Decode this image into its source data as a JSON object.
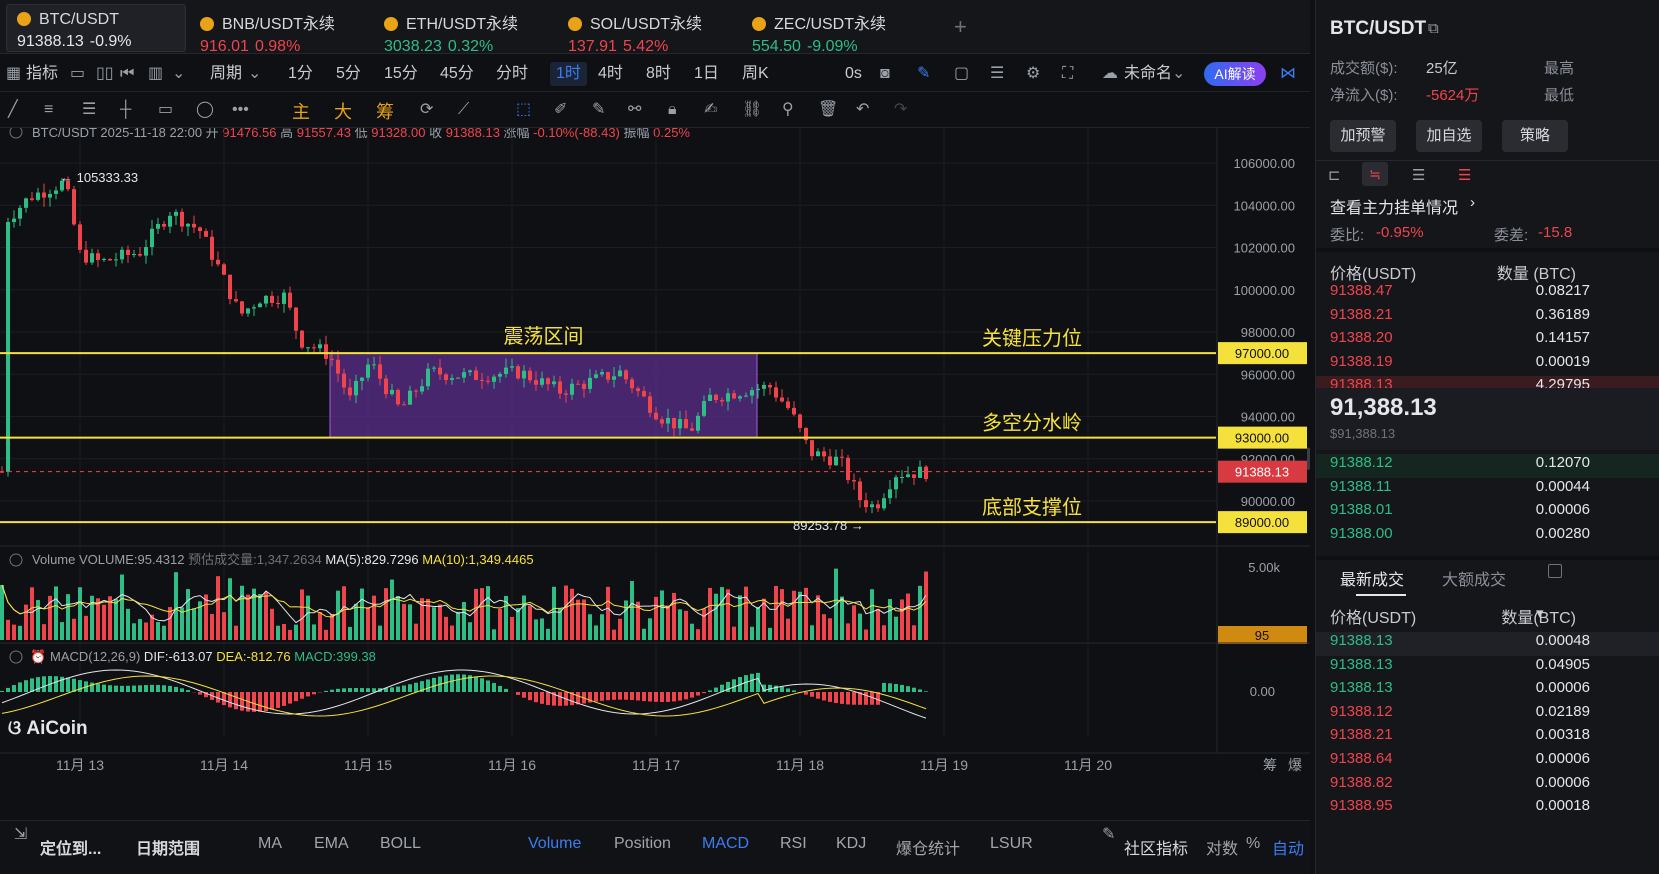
{
  "tickers": [
    {
      "name": "BTC/USDT",
      "price": "91388.13",
      "change": "-0.9%",
      "dir": "dn",
      "active": true
    },
    {
      "name": "BNB/USDT永续",
      "price": "916.01",
      "change": "0.98%",
      "dir": "dn"
    },
    {
      "name": "ETH/USDT永续",
      "price": "3038.23",
      "change": "0.32%",
      "dir": "up"
    },
    {
      "name": "SOL/USDT永续",
      "price": "137.91",
      "change": "5.42%",
      "dir": "dn"
    },
    {
      "name": "ZEC/USDT永续",
      "price": "554.50",
      "change": "-9.09%",
      "dir": "up"
    }
  ],
  "add_tab": "+",
  "toolbar": {
    "indicator": "指标",
    "period": "周期",
    "intervals": [
      "1分",
      "5分",
      "15分",
      "45分",
      "分时",
      "1时",
      "4时",
      "8时",
      "1日",
      "周K"
    ],
    "selected_interval": "1时",
    "countdown": "0s",
    "layout_name": "未命名",
    "ai_button": "AI解读"
  },
  "drawbar": {
    "labels": [
      "主",
      "大",
      "筹"
    ]
  },
  "info_line": {
    "symbol": "BTC/USDT",
    "datetime": "2025-11-18 22:00",
    "open_l": "开",
    "open": "91476.56",
    "high_l": "高",
    "high": "91557.43",
    "low_l": "低",
    "low": "91328.00",
    "close_l": "收",
    "close": "91388.13",
    "chg_l": "涨幅",
    "chg": "-0.10%(-88.43)",
    "amp_l": "振幅",
    "amp": "0.25%"
  },
  "price_axis": [
    "106000.00",
    "104000.00",
    "102000.00",
    "100000.00",
    "98000.00",
    "96000.00",
    "94000.00",
    "92000.00",
    "90000.00"
  ],
  "levels": [
    {
      "value": "97000.00",
      "label": "关键压力位"
    },
    {
      "value": "93000.00",
      "label": "多空分水岭"
    },
    {
      "value": "89000.00",
      "label": "底部支撑位"
    }
  ],
  "current_price": "91388.13",
  "range_box_label": "震荡区间",
  "annotations": {
    "high": "105333.33",
    "low": "89253.78"
  },
  "volume_line": {
    "title": "Volume",
    "vol": "VOLUME:95.4312",
    "est": "预估成交量:1,347.2634",
    "ma5": "MA(5):829.7296",
    "ma10": "MA(10):1,349.4465",
    "axis_top": "5.00k",
    "current": "95"
  },
  "macd_line": {
    "title": "MACD(12,26,9)",
    "dif": "DIF:-613.07",
    "dea": "DEA:-812.76",
    "macd": "MACD:399.38",
    "axis_zero": "0.00"
  },
  "watermark": "AiCoin",
  "dates": [
    "11月 13",
    "11月 14",
    "11月 15",
    "11月 16",
    "11月 17",
    "11月 18",
    "11月 19",
    "11月 20"
  ],
  "axis_corner": [
    "筹",
    "爆"
  ],
  "bottom": {
    "locate": "定位到...",
    "range": "日期范围",
    "inds": [
      "MA",
      "EMA",
      "BOLL",
      "Volume",
      "Position",
      "MACD",
      "RSI",
      "KDJ",
      "爆仓统计",
      "LSUR"
    ],
    "community": "社区指标",
    "log": "对数",
    "pct": "%",
    "auto": "自动"
  },
  "right": {
    "title": "BTC/USDT",
    "turnover_l": "成交额($):",
    "turnover": "25亿",
    "netflow_l": "净流入($):",
    "netflow": "-5624万",
    "hi_l": "最高",
    "lo_l": "最低",
    "buttons": [
      "加预警",
      "加自选",
      "策略"
    ],
    "depth_title": "查看主力挂单情况",
    "ratio_l": "委比:",
    "ratio": "-0.95%",
    "diff_l": "委差:",
    "diff": "-15.8",
    "ob_head": [
      "价格(USDT)",
      "数量 (BTC)"
    ],
    "asks": [
      [
        "91388.47",
        "0.08217"
      ],
      [
        "91388.21",
        "0.36189"
      ],
      [
        "91388.20",
        "0.14157"
      ],
      [
        "91388.19",
        "0.00019"
      ],
      [
        "91388.13",
        "4.29795"
      ]
    ],
    "mid": "91,388.13",
    "mid_usd": "$91,388.13",
    "bids": [
      [
        "91388.12",
        "0.12070"
      ],
      [
        "91388.11",
        "0.00044"
      ],
      [
        "91388.01",
        "0.00006"
      ],
      [
        "91388.00",
        "0.00280"
      ]
    ],
    "trade_tabs": [
      "最新成交",
      "大额成交"
    ],
    "trade_head": [
      "价格(USDT)",
      "数量(BTC)"
    ],
    "trades": [
      [
        "91388.13",
        "0.00048",
        "up"
      ],
      [
        "91388.13",
        "0.04905",
        "up"
      ],
      [
        "91388.13",
        "0.00006",
        "up"
      ],
      [
        "91388.12",
        "0.02189",
        "dn"
      ],
      [
        "91388.21",
        "0.00318",
        "dn"
      ],
      [
        "91388.64",
        "0.00006",
        "dn"
      ],
      [
        "91388.82",
        "0.00006",
        "dn"
      ],
      [
        "91388.95",
        "0.00018",
        "dn"
      ]
    ]
  },
  "colors": {
    "up": "#2ebd85",
    "down": "#f0444d",
    "level": "#f5e13c",
    "box": "#5b2d8e",
    "accent": "#3c7cf0"
  }
}
